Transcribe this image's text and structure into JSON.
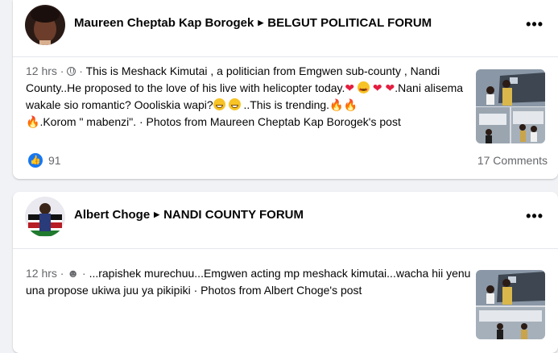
{
  "posts": [
    {
      "author": "Maureen Cheptab Kap Borogek",
      "group": "BELGUT POLITICAL FORUM",
      "time": "12 hrs",
      "privacy_icon": "globe-icon",
      "text_part1": "This is Meshack Kimutai , a politician from Emgwen sub-county , Nandi County..He proposed to the love of his live with helicopter today.",
      "text_part2": ".Nani alisema wakale sio romantic? Oooliskia wapi?",
      "text_part3": " ..This is trending.",
      "text_part4": ".Korom \" mabenzi\". · Photos from Maureen Cheptab Kap Borogek's post",
      "reactions_count": "91",
      "comments_label": "17 Comments"
    },
    {
      "author": "Albert Choge",
      "group": "NANDI COUNTY FORUM",
      "time": "12 hrs",
      "privacy_icon": "friends-icon",
      "text": "...rapishek murechuu...Emgwen acting mp meshack kimutai...wacha hii yenu una propose ukiwa juu ya pikipiki · Photos from Albert Choge's post"
    }
  ],
  "colors": {
    "like_blue": "#1877f2",
    "secondary_text": "#65676b",
    "heart_red": "#e41e3f"
  }
}
